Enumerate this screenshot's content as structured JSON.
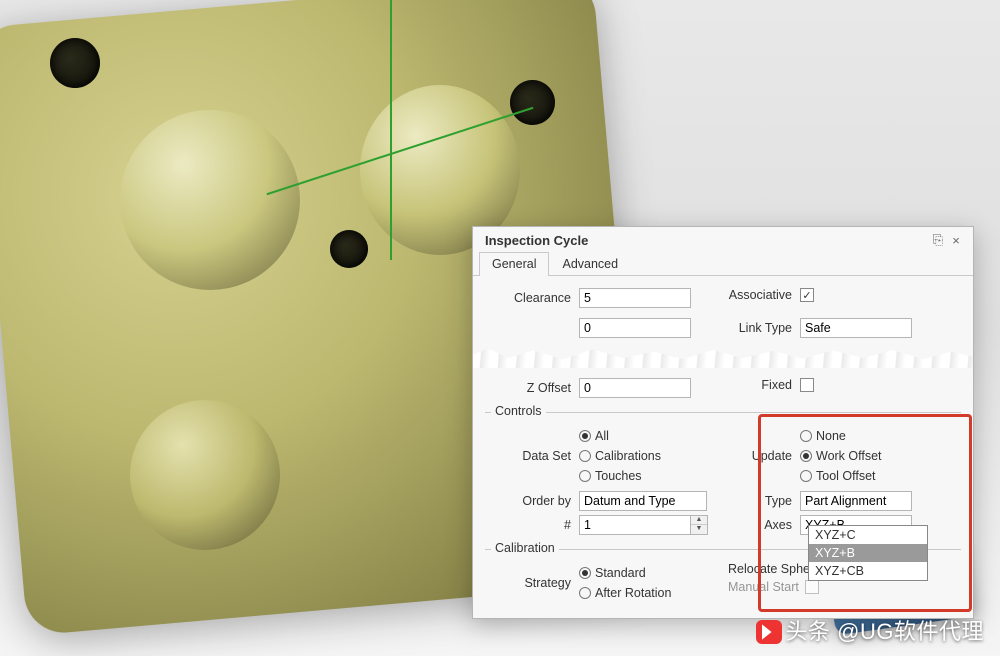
{
  "dialog": {
    "title": "Inspection Cycle",
    "tabs": {
      "general": "General",
      "advanced": "Advanced"
    },
    "close": "×",
    "pin": "⎘",
    "top": {
      "clearance_lbl": "Clearance",
      "clearance_val": "5",
      "blank_val": "0",
      "assoc_lbl": "Associative",
      "assoc_checked": "✓",
      "linktype_lbl": "Link Type",
      "linktype_val": "Safe",
      "zoffset_lbl": "Z Offset",
      "zoffset_val": "0",
      "fixed_lbl": "Fixed"
    },
    "controls": {
      "legend": "Controls",
      "dataset_lbl": "Data Set",
      "dataset_opts": {
        "all": "All",
        "calibrations": "Calibrations",
        "touches": "Touches"
      },
      "orderby_lbl": "Order by",
      "orderby_val": "Datum and Type",
      "hash_lbl": "#",
      "hash_val": "1",
      "update_lbl": "Update",
      "update_opts": {
        "none": "None",
        "work": "Work Offset",
        "tool": "Tool Offset"
      },
      "type_lbl": "Type",
      "type_val": "Part Alignment",
      "axes_lbl": "Axes",
      "axes_val": "XYZ+B",
      "axes_list": {
        "a": "XYZ+C",
        "b": "XYZ+B",
        "c": "XYZ+CB"
      }
    },
    "calibration": {
      "legend": "Calibration",
      "strategy_lbl": "Strategy",
      "strategy_opts": {
        "standard": "Standard",
        "after": "After Rotation"
      },
      "relocate_lbl": "Relocate Sphere",
      "manual_lbl": "Manual Start"
    }
  },
  "watermark": "头条 @UG软件代理"
}
